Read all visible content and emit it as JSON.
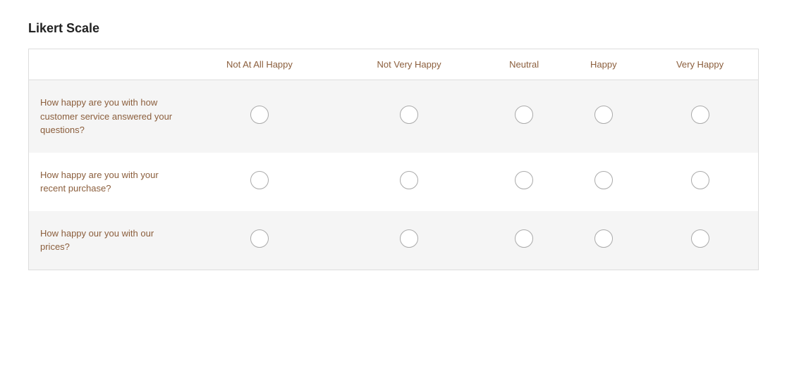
{
  "title": "Likert Scale",
  "columns": [
    {
      "id": "label",
      "text": ""
    },
    {
      "id": "not_at_all_happy",
      "text": "Not At All Happy"
    },
    {
      "id": "not_very_happy",
      "text": "Not Very Happy"
    },
    {
      "id": "neutral",
      "text": "Neutral"
    },
    {
      "id": "happy",
      "text": "Happy"
    },
    {
      "id": "very_happy",
      "text": "Very Happy"
    }
  ],
  "rows": [
    {
      "question": "How happy are you with how customer service answered your questions?"
    },
    {
      "question": "How happy are you with your recent purchase?"
    },
    {
      "question": "How happy our you with our prices?"
    }
  ]
}
